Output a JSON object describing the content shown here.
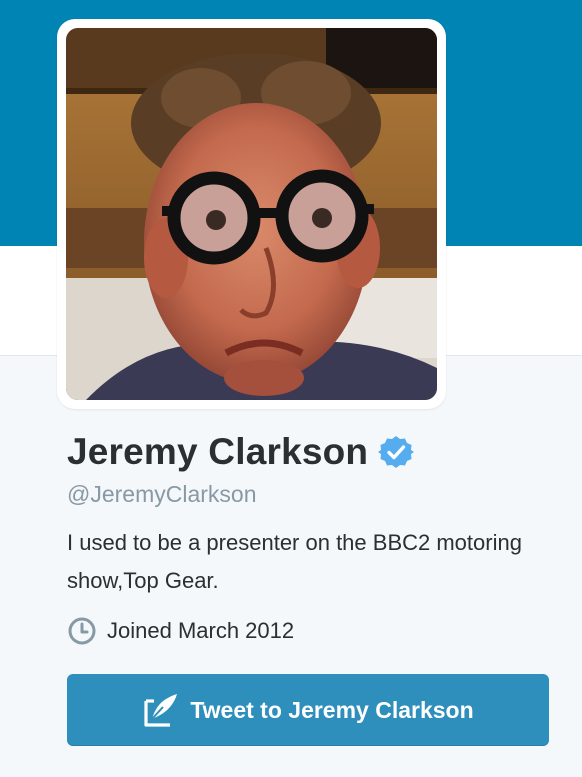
{
  "colors": {
    "banner": "#0084b4",
    "page_background": "#f5f8fa",
    "name_text": "#292f33",
    "handle_text": "#8899a6",
    "verified_badge": "#55acee",
    "tweet_button": "#2e8fbd"
  },
  "profile": {
    "avatar_description": "profile photo",
    "fullname": "Jeremy Clarkson",
    "verified": true,
    "verified_icon": "verified-badge-icon",
    "screen_name": "@JeremyClarkson",
    "bio": "I used to be a presenter on the BBC2 motoring show,Top Gear.",
    "joined_icon": "clock-icon",
    "joined": "Joined March 2012"
  },
  "actions": {
    "tweet_to_icon": "compose-tweet-icon",
    "tweet_to_label": "Tweet to Jeremy Clarkson"
  }
}
